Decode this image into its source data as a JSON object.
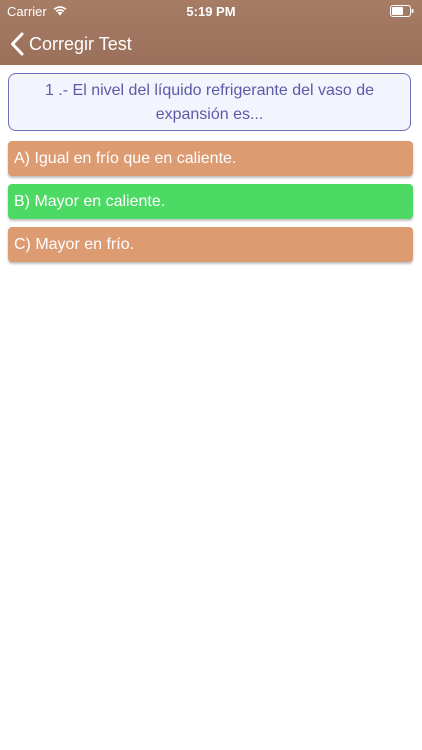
{
  "status_bar": {
    "carrier": "Carrier",
    "time": "5:19 PM"
  },
  "nav": {
    "back_label": "Corregir Test"
  },
  "question": {
    "text": "1 .- El nivel del líquido refrigerante del vaso de expansión es..."
  },
  "options": [
    {
      "label": "A) Igual en frío que en caliente.",
      "color": "#dd9b72"
    },
    {
      "label": "B) Mayor en caliente.",
      "color": "#4cd964"
    },
    {
      "label": "C) Mayor en frío.",
      "color": "#dd9b72"
    }
  ],
  "colors": {
    "nav_background": "#9f755f",
    "question_text": "#5b5aa8",
    "question_border": "#6d6fb8",
    "option_neutral": "#dd9b72",
    "option_correct": "#4cd964"
  },
  "icons": {
    "wifi": "wifi-icon",
    "battery": "battery-icon",
    "back": "chevron-left-icon"
  }
}
